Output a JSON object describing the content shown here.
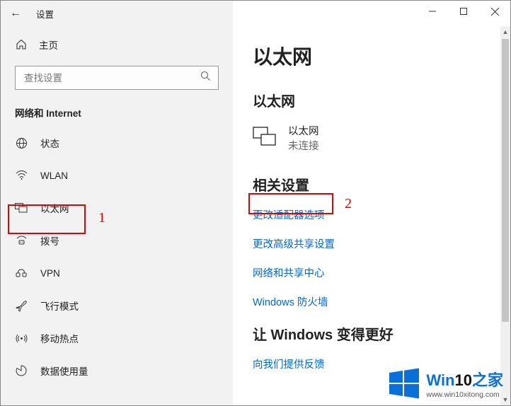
{
  "titlebar": {
    "title": "设置",
    "back_icon": "←"
  },
  "sidebar": {
    "home_label": "主页",
    "search_placeholder": "查找设置",
    "section_label": "网络和 Internet",
    "items": [
      {
        "label": "状态"
      },
      {
        "label": "WLAN"
      },
      {
        "label": "以太网"
      },
      {
        "label": "拨号"
      },
      {
        "label": "VPN"
      },
      {
        "label": "飞行模式"
      },
      {
        "label": "移动热点"
      },
      {
        "label": "数据使用量"
      }
    ]
  },
  "main": {
    "h1": "以太网",
    "h2_status": "以太网",
    "ethernet": {
      "name": "以太网",
      "status": "未连接"
    },
    "h2_related": "相关设置",
    "links": [
      "更改适配器选项",
      "更改高级共享设置",
      "网络和共享中心",
      "Windows 防火墙"
    ],
    "h2_feedback": "让 Windows 变得更好",
    "feedback_link": "向我们提供反馈"
  },
  "annotations": {
    "num1": "1",
    "num2": "2"
  },
  "watermark": {
    "brand_a": "Win",
    "brand_b": "10",
    "brand_c": "之家",
    "url": "www.win10xitong.com"
  }
}
